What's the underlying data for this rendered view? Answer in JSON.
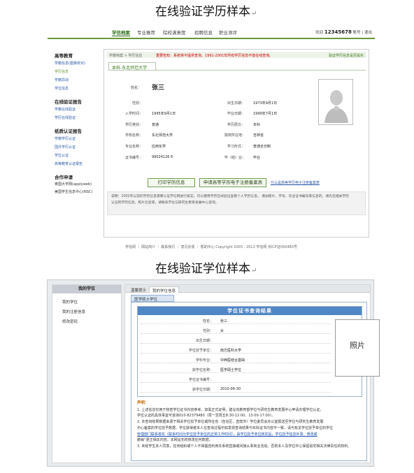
{
  "headings": {
    "top": "在线验证学历样本",
    "bottom": "在线验证学位样本",
    "mark": "↵"
  },
  "top_sample": {
    "nav": {
      "items": [
        "学信档案",
        "专业推荐",
        "院校满意度",
        "招聘信息",
        "职业测评"
      ],
      "active_index": 0,
      "welcome": "欢迎",
      "user_id": "12345678",
      "account": "账号",
      "logout": "退出"
    },
    "sidebar": [
      {
        "title": "高等教育",
        "links": [
          "学籍信息(图像校对)",
          "学历信息",
          "学籍异动",
          "学位信息"
        ],
        "current_index": 1
      },
      {
        "title": "在线验证报告",
        "links": [
          "学籍在线验证",
          "学历在线验证"
        ]
      },
      {
        "title": "纸质认证报告",
        "links": [
          "学籍学历认证",
          "国外学历认证",
          "学位认证",
          "高等教育认证报告"
        ]
      },
      {
        "title": "合作申请",
        "texts": [
          "英国大学网(applyweb)",
          "美国学生信息中心(NSC)"
        ]
      }
    ],
    "breadcrumb": {
      "home": "学籍档案",
      "current": "学历信息",
      "notice_red": "重要告知：系统将不提供查询，1991-2001年所有学历信息不能在线查询。",
      "notice_green": "验证学历信息是否属实"
    },
    "tab": "本科-东北师范大学",
    "fields_left": [
      {
        "label": "姓名：",
        "value": "张三"
      },
      {
        "label": "性别：",
        "value": ""
      },
      {
        "label": "入学时间：",
        "value": "1995年9月1日"
      },
      {
        "label": "学历类别：",
        "value": "普通"
      },
      {
        "label": "学校名称：",
        "value": "东北师范大学"
      },
      {
        "label": "专业名称：",
        "value": "应用化学"
      },
      {
        "label": "证书编号：",
        "value": "99024126 6"
      }
    ],
    "fields_right": [
      {
        "label": "出生日期：",
        "value": "1973年9月1日"
      },
      {
        "label": "毕业日期：",
        "value": "1999年7月1日"
      },
      {
        "label": "学历层次：",
        "value": "本科"
      },
      {
        "label": "院校所在地：",
        "value": "吉林省"
      },
      {
        "label": "学习形式：",
        "value": "普通全日制"
      },
      {
        "label": "毕（结）业：",
        "value": "毕业"
      }
    ],
    "buttons": {
      "print": "打印学历信息",
      "apply": "申请高等学历电子注册备案表"
    },
    "xml_link": "什么是高等学历电子注册备案表",
    "notice_lines": [
      "说明：2002年以前的学历信息需要认证学信网进行核实，可以使用学历在线验证查看个人学历信息。  增加照片、学号、毕业证书编号等信息的，请先在相关学历",
      "认证的学历信息，照片信息等，请联系学位与研究生教育发展中心咨询。"
    ],
    "footer": "学信网 ｜ 网站简介 ｜ 联系我们 ｜ 意见反馈 ｜ 帮助中心    Copyright 2003 - 2013 学信网  京ICP证050483号"
  },
  "bottom_sample": {
    "sidebar_title": "我的学位",
    "sidebar_links": [
      "我的学位",
      "我的注册信息",
      "修改密码"
    ],
    "tabs": [
      "温馨提示",
      "我的学位信息"
    ],
    "active_tab": 1,
    "subtab": "医学硕士学位",
    "cert_title": "学位证书查询结果",
    "cert_fields": [
      {
        "label": "姓名：",
        "value": "张三"
      },
      {
        "label": "性别：",
        "value": "女"
      },
      {
        "label": "出生日期：",
        "value": ""
      },
      {
        "label": "学位授予单位：",
        "value": "南方医科大学"
      },
      {
        "label": "学科专业：",
        "value": "中西医结合基础"
      },
      {
        "label": "获学位名称：",
        "value": "医学硕士学位"
      },
      {
        "label": "学位证书编号：",
        "value": ""
      },
      {
        "label": "获学位日期：",
        "value": "2010-06-30"
      }
    ],
    "photo_label": "照片",
    "declaration": {
      "title": "声明：",
      "lines": [
        "1. 上述信息仅用于核查学位证书内容参考。如需正式证明，建议向教育部学位与研究生教育发展中心申请办理学位认证。",
        "学位认证的具体事宜可咨询010-82379480（周一至周五8:30-12:00、13:00-17:00）。",
        "2. 本查询结果数据来源于相关学位授予单位或所在省（自治区、直辖市）学位委员会办公室报送至学位与研究生教育发展",
        "中心备案的学位授予数据。学位获得者本人在查询过程中如发现查询结果与实际证书内容不一致，请与有关学位授予单位的学位",
        "管理部门联系核实（联系时间为学位授予单位的正常工作时间），由学位授予单位核实后，学位授予信息补录、修改或",
        "撤销“更正相关内容。本网站无权修改任何数据。",
        "3. 未经学生本人同意，任何组织或个人不得擅自利用本系统直接或间接从事商业活动。否则本人及学位中心保留追究相关法律责任的权利。"
      ]
    }
  }
}
